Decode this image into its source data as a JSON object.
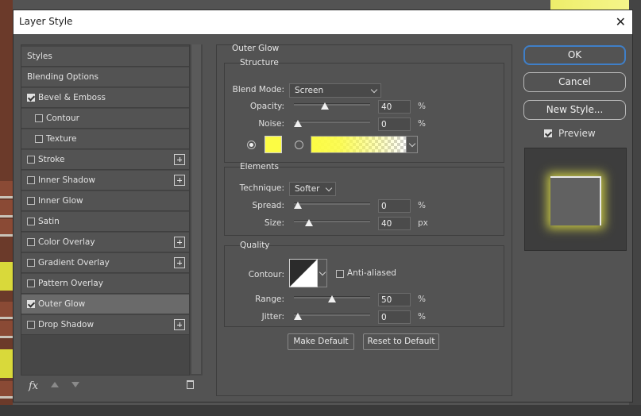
{
  "window": {
    "title": "Layer Style"
  },
  "styles_list": [
    {
      "label": "Styles",
      "checkbox": false,
      "checked": false,
      "plus": false,
      "indent": 0,
      "selected": false
    },
    {
      "label": "Blending Options",
      "checkbox": false,
      "checked": false,
      "plus": false,
      "indent": 0,
      "selected": false
    },
    {
      "label": "Bevel & Emboss",
      "checkbox": true,
      "checked": true,
      "plus": false,
      "indent": 0,
      "selected": false
    },
    {
      "label": "Contour",
      "checkbox": true,
      "checked": false,
      "plus": false,
      "indent": 1,
      "selected": false
    },
    {
      "label": "Texture",
      "checkbox": true,
      "checked": false,
      "plus": false,
      "indent": 1,
      "selected": false
    },
    {
      "label": "Stroke",
      "checkbox": true,
      "checked": false,
      "plus": true,
      "indent": 0,
      "selected": false
    },
    {
      "label": "Inner Shadow",
      "checkbox": true,
      "checked": false,
      "plus": true,
      "indent": 0,
      "selected": false
    },
    {
      "label": "Inner Glow",
      "checkbox": true,
      "checked": false,
      "plus": false,
      "indent": 0,
      "selected": false
    },
    {
      "label": "Satin",
      "checkbox": true,
      "checked": false,
      "plus": false,
      "indent": 0,
      "selected": false
    },
    {
      "label": "Color Overlay",
      "checkbox": true,
      "checked": false,
      "plus": true,
      "indent": 0,
      "selected": false
    },
    {
      "label": "Gradient Overlay",
      "checkbox": true,
      "checked": false,
      "plus": true,
      "indent": 0,
      "selected": false
    },
    {
      "label": "Pattern Overlay",
      "checkbox": true,
      "checked": false,
      "plus": false,
      "indent": 0,
      "selected": false
    },
    {
      "label": "Outer Glow",
      "checkbox": true,
      "checked": true,
      "plus": false,
      "indent": 0,
      "selected": true
    },
    {
      "label": "Drop Shadow",
      "checkbox": true,
      "checked": false,
      "plus": true,
      "indent": 0,
      "selected": false
    }
  ],
  "footer": {
    "fx_label": "fx"
  },
  "panel": {
    "title": "Outer Glow",
    "structure": {
      "title": "Structure",
      "blend_mode_label": "Blend Mode:",
      "blend_mode_value": "Screen",
      "opacity_label": "Opacity:",
      "opacity_value": "40",
      "opacity_unit": "%",
      "opacity_fraction": 0.4,
      "noise_label": "Noise:",
      "noise_value": "0",
      "noise_unit": "%",
      "noise_fraction": 0,
      "glow_color": "#fcfc44"
    },
    "elements": {
      "title": "Elements",
      "technique_label": "Technique:",
      "technique_value": "Softer",
      "spread_label": "Spread:",
      "spread_value": "0",
      "spread_unit": "%",
      "spread_fraction": 0,
      "size_label": "Size:",
      "size_value": "40",
      "size_unit": "px",
      "size_fraction": 0.16
    },
    "quality": {
      "title": "Quality",
      "contour_label": "Contour:",
      "anti_aliased_label": "Anti-aliased",
      "anti_aliased_checked": false,
      "range_label": "Range:",
      "range_value": "50",
      "range_unit": "%",
      "range_fraction": 0.5,
      "jitter_label": "Jitter:",
      "jitter_value": "0",
      "jitter_unit": "%",
      "jitter_fraction": 0
    },
    "make_default_label": "Make Default",
    "reset_default_label": "Reset to Default"
  },
  "actions": {
    "ok_label": "OK",
    "cancel_label": "Cancel",
    "new_style_label": "New Style...",
    "preview_label": "Preview",
    "preview_checked": true
  },
  "colors": {
    "accent": "#3f7fc8",
    "glow": "#fcfc44"
  }
}
